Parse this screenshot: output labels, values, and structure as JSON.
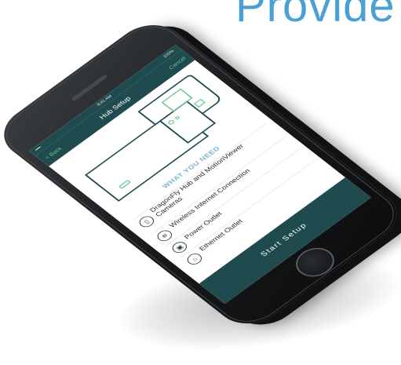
{
  "background": {
    "partial_word": "Provide"
  },
  "status": {
    "signal": "•••••",
    "time": "9:41 AM",
    "battery": "100%"
  },
  "nav": {
    "back": "< Back",
    "title": "Hub Setup",
    "cancel": "Cancel"
  },
  "section_title": "WHAT YOU NEED",
  "requirements": [
    {
      "label": "DragonFly Hub and MotionViewer Cameras",
      "icon": "camera-icon"
    },
    {
      "label": "Wireless Internet Connection",
      "icon": "wifi-icon"
    },
    {
      "label": "Power Outlet",
      "icon": "power-outlet-icon"
    },
    {
      "label": "Ethernet Outlet",
      "icon": "ethernet-icon"
    }
  ],
  "cta": {
    "label": "Start Setup"
  },
  "colors": {
    "teal": "#1f4a4e",
    "green": "#67c78f",
    "accent_blue": "#7fb6cf"
  }
}
